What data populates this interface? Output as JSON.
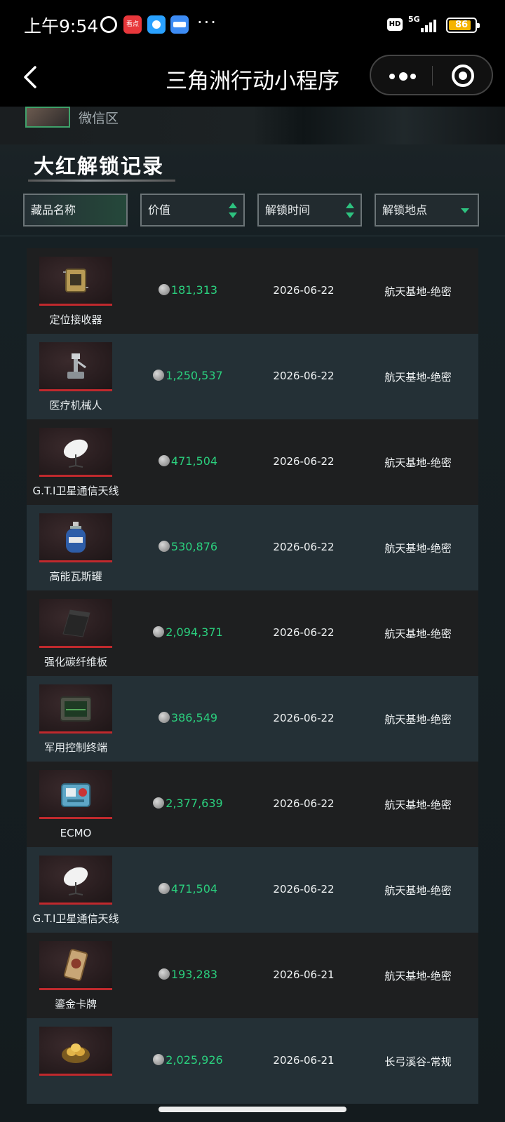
{
  "status_bar": {
    "time": "上午9:54",
    "red_app_label": "看点",
    "more": "···",
    "hd": "HD",
    "network": "5G",
    "battery": "86",
    "battery_level": 0.86
  },
  "nav": {
    "title": "三角洲行动小程序"
  },
  "banner": {
    "label": "微信区"
  },
  "section": {
    "title": "大红解锁记录"
  },
  "filters": [
    {
      "label": "藏品名称"
    },
    {
      "label": "价值"
    },
    {
      "label": "解锁时间"
    },
    {
      "label": "解锁地点"
    }
  ],
  "records": [
    {
      "name": "定位接收器",
      "value": "181,313",
      "date": "2026-06-22",
      "place": "航天基地-绝密",
      "icon": "receiver-icon"
    },
    {
      "name": "医疗机械人",
      "value": "1,250,537",
      "date": "2026-06-22",
      "place": "航天基地-绝密",
      "icon": "medical-robot-icon"
    },
    {
      "name": "G.T.I卫星通信天线",
      "value": "471,504",
      "date": "2026-06-22",
      "place": "航天基地-绝密",
      "icon": "satellite-dish-icon"
    },
    {
      "name": "高能瓦斯罐",
      "value": "530,876",
      "date": "2026-06-22",
      "place": "航天基地-绝密",
      "icon": "gas-canister-icon"
    },
    {
      "name": "强化碳纤维板",
      "value": "2,094,371",
      "date": "2026-06-22",
      "place": "航天基地-绝密",
      "icon": "carbon-plate-icon"
    },
    {
      "name": "军用控制终端",
      "value": "386,549",
      "date": "2026-06-22",
      "place": "航天基地-绝密",
      "icon": "control-terminal-icon"
    },
    {
      "name": "ECMO",
      "value": "2,377,639",
      "date": "2026-06-22",
      "place": "航天基地-绝密",
      "icon": "ecmo-icon"
    },
    {
      "name": "G.T.I卫星通信天线",
      "value": "471,504",
      "date": "2026-06-22",
      "place": "航天基地-绝密",
      "icon": "satellite-dish-icon"
    },
    {
      "name": "鎏金卡牌",
      "value": "193,283",
      "date": "2026-06-21",
      "place": "航天基地-绝密",
      "icon": "gold-card-icon"
    },
    {
      "name": "",
      "value": "2,025,926",
      "date": "2026-06-21",
      "place": "长弓溪谷-常规",
      "icon": "golden-nest-icon"
    }
  ]
}
